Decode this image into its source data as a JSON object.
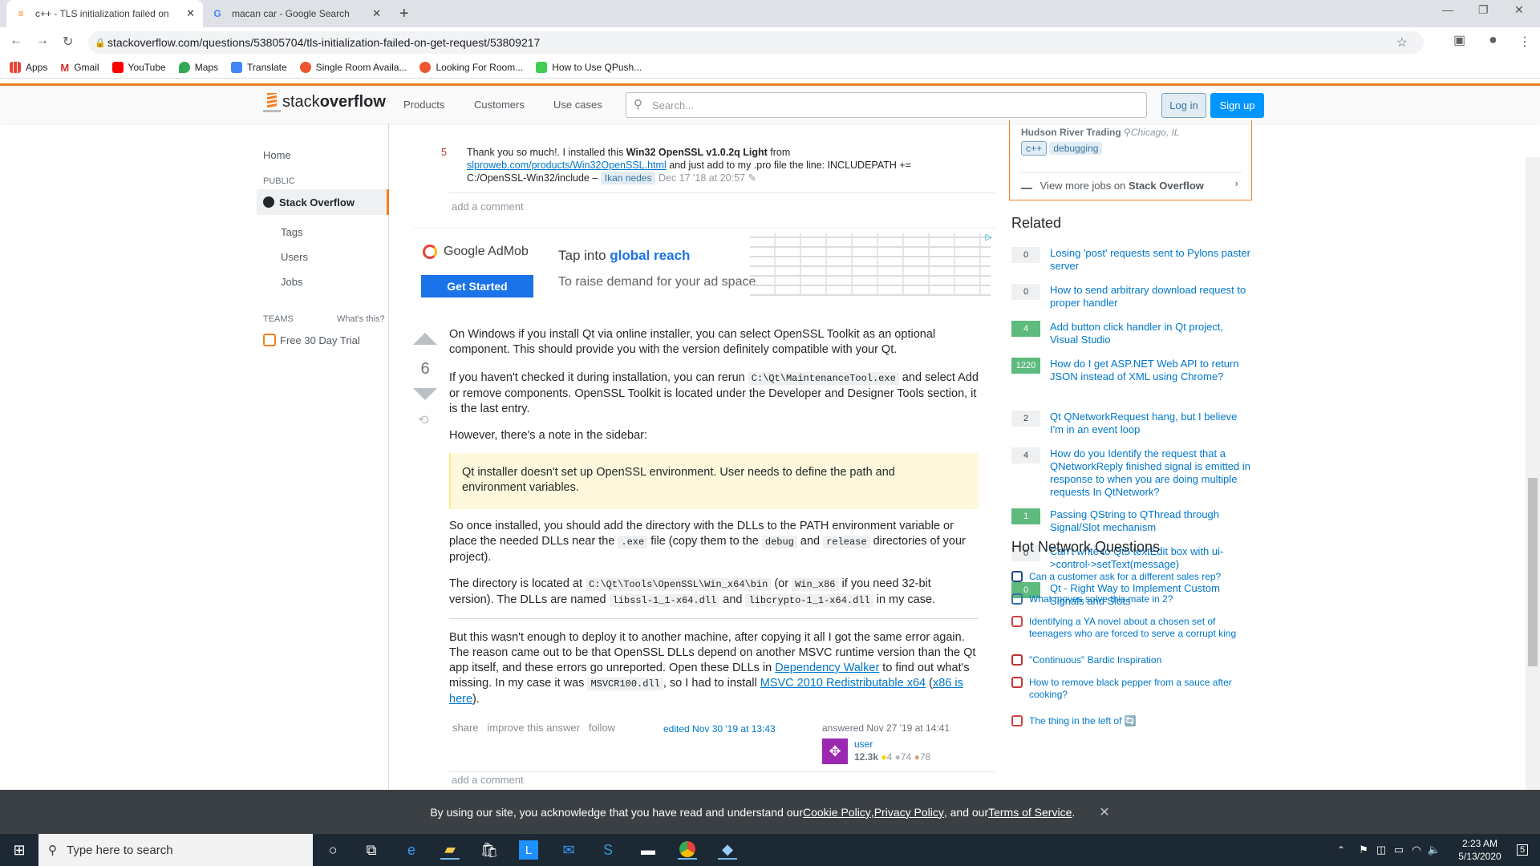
{
  "browser": {
    "tabs": [
      {
        "title": "c++ - TLS initialization failed on",
        "active": true
      },
      {
        "title": "macan car - Google Search",
        "active": false
      }
    ],
    "url": "stackoverflow.com/questions/53805704/tls-initialization-failed-on-get-request/53809217",
    "bookmarks": [
      "Apps",
      "Gmail",
      "YouTube",
      "Maps",
      "Translate",
      "Single Room Availa...",
      "Looking For Room...",
      "How to Use QPush..."
    ]
  },
  "so_header": {
    "logo_text_light": "stack",
    "logo_text_bold": "overflow",
    "nav": [
      "Products",
      "Customers",
      "Use cases"
    ],
    "search_placeholder": "Search...",
    "login": "Log in",
    "signup": "Sign up"
  },
  "left_nav": {
    "home": "Home",
    "public": "PUBLIC",
    "stack_overflow": "Stack Overflow",
    "tags": "Tags",
    "users": "Users",
    "jobs": "Jobs",
    "teams": "TEAMS",
    "whats_this": "What's this?",
    "free_trial": "Free 30 Day Trial"
  },
  "comment": {
    "score": "5",
    "text_pre": "Thank you so much!. I installed this ",
    "text_bold": "Win32 OpenSSL v1.0.2q Light",
    "text_from": " from",
    "link": "slproweb.com/products/Win32OpenSSL.html",
    "text_post": " and just add to my .pro file the line: INCLUDEPATH +=",
    "text_line3": "C:/OpenSSL-Win32/include – ",
    "user": "Ikan nedes",
    "date": "Dec 17 '18 at 20:57",
    "add_comment": "add a comment"
  },
  "ad": {
    "brand": "Google AdMob",
    "button": "Get Started",
    "line1_pre": "Tap into ",
    "line1_bold": "global reach",
    "line2": "To raise demand for your ad space"
  },
  "answer": {
    "votes": "6",
    "p1": "On Windows if you install Qt via online installer, you can select OpenSSL Toolkit as an optional component. This should provide you with the version definitely compatible with your Qt.",
    "p2_a": "If you haven't checked it during installation, you can rerun ",
    "p2_code": "C:\\Qt\\MaintenanceTool.exe",
    "p2_b": " and select Add or remove components. OpenSSL Toolkit is located under the Developer and Designer Tools section, it is the last entry.",
    "p3": "However, there's a note in the sidebar:",
    "quote": "Qt installer doesn't set up OpenSSL environment. User needs to define the path and environment variables.",
    "p4_a": "So once installed, you should add the directory with the DLLs to the PATH environment variable or place the needed DLLs near the ",
    "p4_code1": ".exe",
    "p4_b": " file (copy them to the ",
    "p4_code2": "debug",
    "p4_c": " and ",
    "p4_code3": "release",
    "p4_d": " directories of your project).",
    "p5_a": "The directory is located at ",
    "p5_code1": "C:\\Qt\\Tools\\OpenSSL\\Win_x64\\bin",
    "p5_b": " (or ",
    "p5_code2": "Win_x86",
    "p5_c": " if you need 32-bit version). The DLLs are named ",
    "p5_code3": "libssl-1_1-x64.dll",
    "p5_d": " and ",
    "p5_code4": "libcrypto-1_1-x64.dll",
    "p5_e": " in my case.",
    "p6_a": "But this wasn't enough to deploy it to another machine, after copying it all I got the same error again. The reason came out to be that OpenSSL DLLs depend on another MSVC runtime version than the Qt app itself, and these errors go unreported. Open these DLLs in ",
    "p6_link1": "Dependency Walker",
    "p6_b": " to find out what's missing. In my case it was ",
    "p6_code": "MSVCR100.dll",
    "p6_c": ", so I had to install ",
    "p6_link2": "MSVC 2010 Redistributable x64",
    "p6_d": " (",
    "p6_link3": "x86 is here",
    "p6_e": ").",
    "share": "share",
    "improve": "improve this answer",
    "follow": "follow",
    "edited": "edited Nov 30 '19 at 13:43",
    "answered": "answered Nov 27 '19 at 14:41",
    "user_name": "user",
    "rep": "12.3k",
    "gold": "4",
    "silver": "74",
    "bronze": "78",
    "add_comment": "add a comment"
  },
  "sidebar": {
    "job_company": "Hudson River Trading",
    "job_location": "Chicago, IL",
    "job_tags": [
      "c++",
      "debugging"
    ],
    "more_jobs_pre": "View more jobs on ",
    "more_jobs_bold": "Stack Overflow",
    "related_title": "Related",
    "related": [
      {
        "count": "0",
        "accepted": false,
        "title": "Losing 'post' requests sent to Pylons paster server"
      },
      {
        "count": "0",
        "accepted": false,
        "title": "How to send arbitrary download request to proper handler"
      },
      {
        "count": "4",
        "accepted": true,
        "title": "Add button click handler in Qt project, Visual Studio"
      },
      {
        "count": "1220",
        "accepted": true,
        "title": "How do I get ASP.NET Web API to return JSON instead of XML using Chrome?"
      },
      {
        "count": "2",
        "accepted": false,
        "title": "Qt QNetworkRequest hang, but I believe I'm in an event loop"
      },
      {
        "count": "4",
        "accepted": false,
        "title": "How do you Identify the request that a QNetworkReply finished signal is emitted in response to when you are doing multiple requests In QtNetwork?"
      },
      {
        "count": "1",
        "accepted": true,
        "title": "Passing QString to QThread through Signal/Slot mechanism"
      },
      {
        "count": "0",
        "accepted": false,
        "title": "Can't write to Qt5 textEdit box with ui->control->setText(message)"
      },
      {
        "count": "0",
        "accepted": true,
        "title": "Qt - Right Way to Implement Custom Signals and Slots"
      }
    ],
    "hnq_title": "Hot Network Questions",
    "hnq": [
      "Can a customer ask for a different sales rep?",
      "What moves solve this mate in 2?",
      "Identifying a YA novel about a chosen set of teenagers who are forced to serve a corrupt king",
      "\"Continuous\" Bardic Inspiration",
      "How to remove black pepper from a sauce after cooking?",
      "The thing in the left of 🔄"
    ],
    "hnq_colors": [
      "#1a4a8a",
      "#3a6fb0",
      "#c44",
      "#b33",
      "#c33",
      "#c44"
    ]
  },
  "cookie": {
    "pre": "By using our site, you acknowledge that you have read and understand our ",
    "cookie_policy": "Cookie Policy",
    "sep1": ", ",
    "privacy_policy": "Privacy Policy",
    "sep2": ", and our ",
    "terms": "Terms of Service",
    "end": "."
  },
  "taskbar": {
    "search_placeholder": "Type here to search",
    "time": "2:23 AM",
    "date": "5/13/2020",
    "notification_count": "5"
  }
}
